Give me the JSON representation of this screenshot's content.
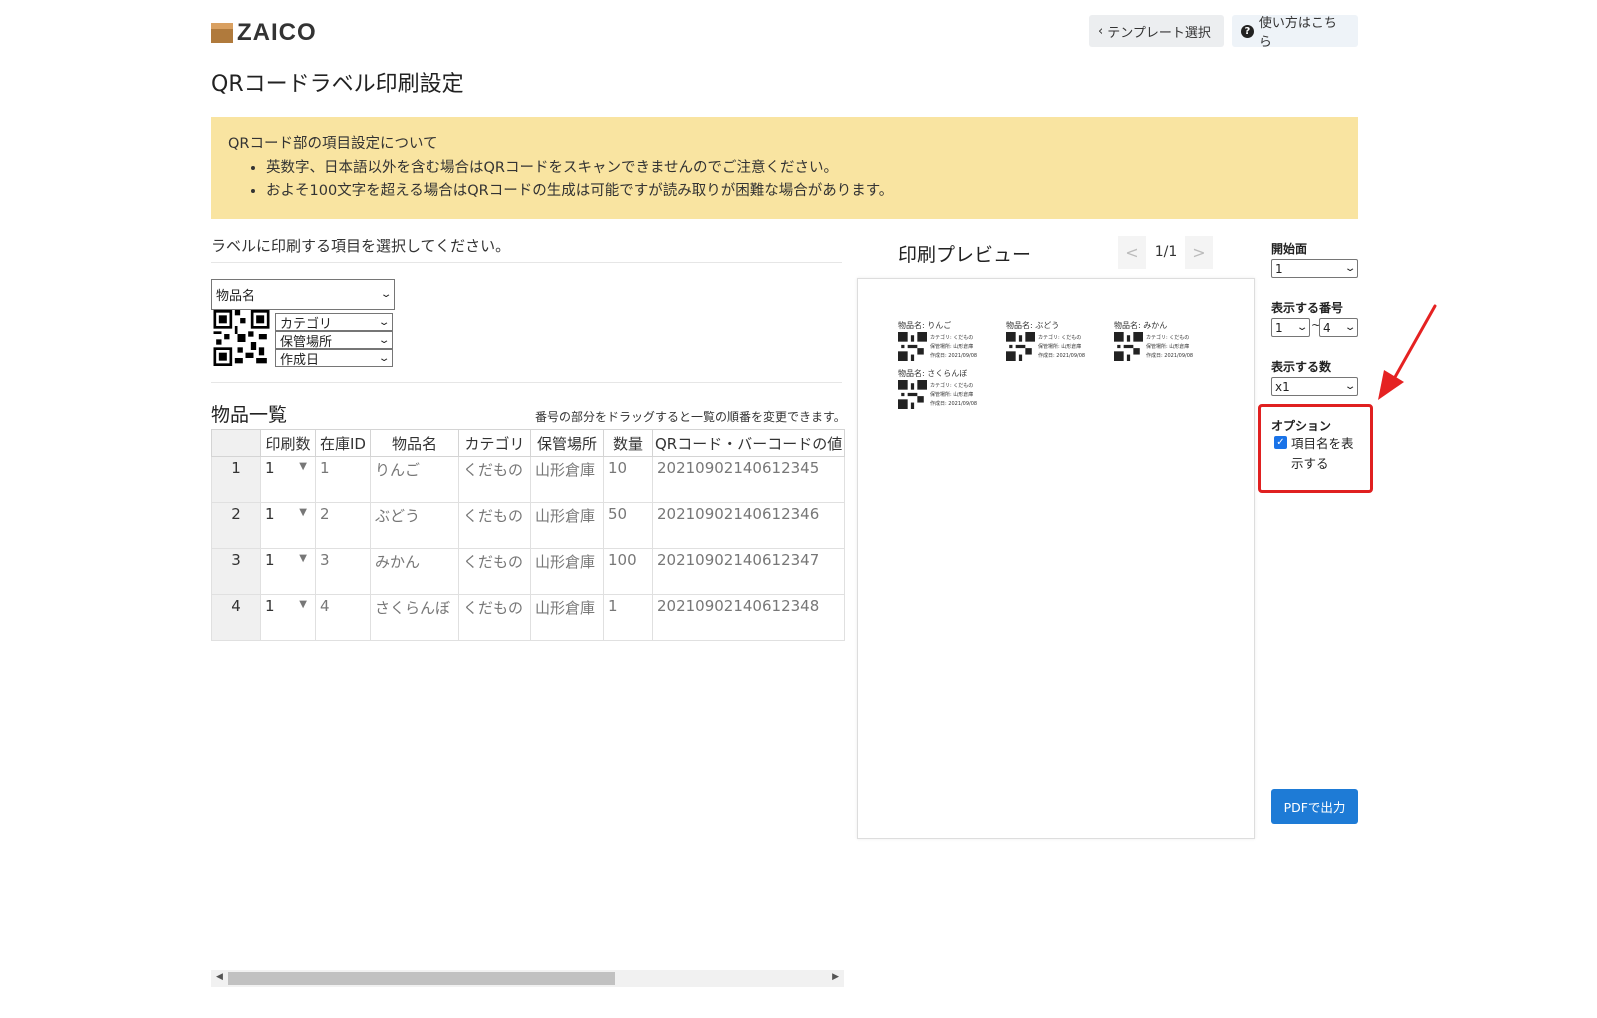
{
  "header": {
    "logo_text": "ZAICO",
    "template_button": "テンプレート選択",
    "help_button": "使い方はこちら"
  },
  "page_title": "QRコードラベル印刷設定",
  "notice": {
    "title": "QRコード部の項目設定について",
    "items": [
      "英数字、日本語以外を含む場合はQRコードをスキャンできませんのでご注意ください。",
      "およそ100文字を超える場合はQRコードの生成は可能ですが読み取りが困難な場合があります。"
    ]
  },
  "label_settings": {
    "prompt": "ラベルに印刷する項目を選択してください。",
    "top_field": "物品名",
    "side_fields": [
      "カテゴリ",
      "保管場所",
      "作成日"
    ]
  },
  "items_list": {
    "title": "物品一覧",
    "drag_note": "番号の部分をドラッグすると一覧の順番を変更できます。",
    "columns": [
      "",
      "印刷数",
      "在庫ID",
      "物品名",
      "カテゴリ",
      "保管場所",
      "数量",
      "QRコード・バーコードの値"
    ],
    "rows": [
      {
        "num": "1",
        "print_count": "1",
        "id": "1",
        "name": "りんご",
        "category": "くだもの",
        "location": "山形倉庫",
        "qty": "10",
        "code": "20210902140612345"
      },
      {
        "num": "2",
        "print_count": "1",
        "id": "2",
        "name": "ぶどう",
        "category": "くだもの",
        "location": "山形倉庫",
        "qty": "50",
        "code": "20210902140612346"
      },
      {
        "num": "3",
        "print_count": "1",
        "id": "3",
        "name": "みかん",
        "category": "くだもの",
        "location": "山形倉庫",
        "qty": "100",
        "code": "20210902140612347"
      },
      {
        "num": "4",
        "print_count": "1",
        "id": "4",
        "name": "さくらんぼ",
        "category": "くだもの",
        "location": "山形倉庫",
        "qty": "1",
        "code": "20210902140612348"
      }
    ]
  },
  "preview": {
    "title": "印刷プレビュー",
    "page_indicator": "1/1",
    "labels": [
      {
        "name": "物品名: りんご",
        "lines": [
          "カテゴリ: くだもの",
          "保管場所: 山形倉庫",
          "作成日: 2021/09/08"
        ]
      },
      {
        "name": "物品名: ぶどう",
        "lines": [
          "カテゴリ: くだもの",
          "保管場所: 山形倉庫",
          "作成日: 2021/09/08"
        ]
      },
      {
        "name": "物品名: みかん",
        "lines": [
          "カテゴリ: くだもの",
          "保管場所: 山形倉庫",
          "作成日: 2021/09/08"
        ]
      },
      {
        "name": "物品名: さくらんぼ",
        "lines": [
          "カテゴリ: くだもの",
          "保管場所: 山形倉庫",
          "作成日: 2021/09/08"
        ]
      }
    ]
  },
  "settings": {
    "start_label": "開始面",
    "start_value": "1",
    "range_label": "表示する番号",
    "range_from": "1",
    "range_separator": "~",
    "range_to": "4",
    "count_label": "表示する数",
    "count_value": "x1",
    "option_label": "オプション",
    "option_checkbox_label": "項目名を表示する",
    "option_checked": true,
    "pdf_button": "PDFで出力"
  },
  "colors": {
    "notice_bg": "#f9e4a1",
    "primary_button": "#1e7bd6",
    "highlight": "#e02020"
  }
}
